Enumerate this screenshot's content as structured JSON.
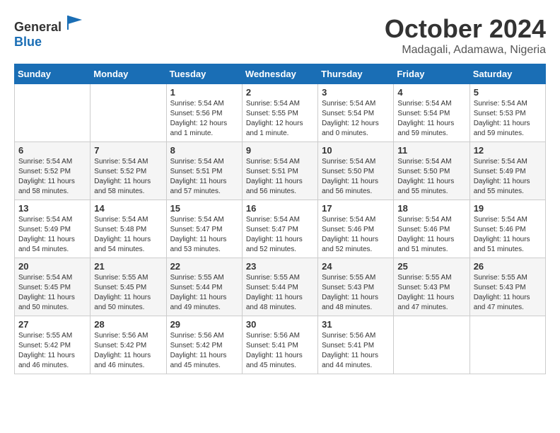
{
  "logo": {
    "general": "General",
    "blue": "Blue"
  },
  "title": "October 2024",
  "location": "Madagali, Adamawa, Nigeria",
  "days_header": [
    "Sunday",
    "Monday",
    "Tuesday",
    "Wednesday",
    "Thursday",
    "Friday",
    "Saturday"
  ],
  "weeks": [
    [
      {
        "day": "",
        "sunrise": "",
        "sunset": "",
        "daylight": ""
      },
      {
        "day": "",
        "sunrise": "",
        "sunset": "",
        "daylight": ""
      },
      {
        "day": "1",
        "sunrise": "Sunrise: 5:54 AM",
        "sunset": "Sunset: 5:56 PM",
        "daylight": "Daylight: 12 hours and 1 minute."
      },
      {
        "day": "2",
        "sunrise": "Sunrise: 5:54 AM",
        "sunset": "Sunset: 5:55 PM",
        "daylight": "Daylight: 12 hours and 1 minute."
      },
      {
        "day": "3",
        "sunrise": "Sunrise: 5:54 AM",
        "sunset": "Sunset: 5:54 PM",
        "daylight": "Daylight: 12 hours and 0 minutes."
      },
      {
        "day": "4",
        "sunrise": "Sunrise: 5:54 AM",
        "sunset": "Sunset: 5:54 PM",
        "daylight": "Daylight: 11 hours and 59 minutes."
      },
      {
        "day": "5",
        "sunrise": "Sunrise: 5:54 AM",
        "sunset": "Sunset: 5:53 PM",
        "daylight": "Daylight: 11 hours and 59 minutes."
      }
    ],
    [
      {
        "day": "6",
        "sunrise": "Sunrise: 5:54 AM",
        "sunset": "Sunset: 5:52 PM",
        "daylight": "Daylight: 11 hours and 58 minutes."
      },
      {
        "day": "7",
        "sunrise": "Sunrise: 5:54 AM",
        "sunset": "Sunset: 5:52 PM",
        "daylight": "Daylight: 11 hours and 58 minutes."
      },
      {
        "day": "8",
        "sunrise": "Sunrise: 5:54 AM",
        "sunset": "Sunset: 5:51 PM",
        "daylight": "Daylight: 11 hours and 57 minutes."
      },
      {
        "day": "9",
        "sunrise": "Sunrise: 5:54 AM",
        "sunset": "Sunset: 5:51 PM",
        "daylight": "Daylight: 11 hours and 56 minutes."
      },
      {
        "day": "10",
        "sunrise": "Sunrise: 5:54 AM",
        "sunset": "Sunset: 5:50 PM",
        "daylight": "Daylight: 11 hours and 56 minutes."
      },
      {
        "day": "11",
        "sunrise": "Sunrise: 5:54 AM",
        "sunset": "Sunset: 5:50 PM",
        "daylight": "Daylight: 11 hours and 55 minutes."
      },
      {
        "day": "12",
        "sunrise": "Sunrise: 5:54 AM",
        "sunset": "Sunset: 5:49 PM",
        "daylight": "Daylight: 11 hours and 55 minutes."
      }
    ],
    [
      {
        "day": "13",
        "sunrise": "Sunrise: 5:54 AM",
        "sunset": "Sunset: 5:49 PM",
        "daylight": "Daylight: 11 hours and 54 minutes."
      },
      {
        "day": "14",
        "sunrise": "Sunrise: 5:54 AM",
        "sunset": "Sunset: 5:48 PM",
        "daylight": "Daylight: 11 hours and 54 minutes."
      },
      {
        "day": "15",
        "sunrise": "Sunrise: 5:54 AM",
        "sunset": "Sunset: 5:47 PM",
        "daylight": "Daylight: 11 hours and 53 minutes."
      },
      {
        "day": "16",
        "sunrise": "Sunrise: 5:54 AM",
        "sunset": "Sunset: 5:47 PM",
        "daylight": "Daylight: 11 hours and 52 minutes."
      },
      {
        "day": "17",
        "sunrise": "Sunrise: 5:54 AM",
        "sunset": "Sunset: 5:46 PM",
        "daylight": "Daylight: 11 hours and 52 minutes."
      },
      {
        "day": "18",
        "sunrise": "Sunrise: 5:54 AM",
        "sunset": "Sunset: 5:46 PM",
        "daylight": "Daylight: 11 hours and 51 minutes."
      },
      {
        "day": "19",
        "sunrise": "Sunrise: 5:54 AM",
        "sunset": "Sunset: 5:46 PM",
        "daylight": "Daylight: 11 hours and 51 minutes."
      }
    ],
    [
      {
        "day": "20",
        "sunrise": "Sunrise: 5:54 AM",
        "sunset": "Sunset: 5:45 PM",
        "daylight": "Daylight: 11 hours and 50 minutes."
      },
      {
        "day": "21",
        "sunrise": "Sunrise: 5:55 AM",
        "sunset": "Sunset: 5:45 PM",
        "daylight": "Daylight: 11 hours and 50 minutes."
      },
      {
        "day": "22",
        "sunrise": "Sunrise: 5:55 AM",
        "sunset": "Sunset: 5:44 PM",
        "daylight": "Daylight: 11 hours and 49 minutes."
      },
      {
        "day": "23",
        "sunrise": "Sunrise: 5:55 AM",
        "sunset": "Sunset: 5:44 PM",
        "daylight": "Daylight: 11 hours and 48 minutes."
      },
      {
        "day": "24",
        "sunrise": "Sunrise: 5:55 AM",
        "sunset": "Sunset: 5:43 PM",
        "daylight": "Daylight: 11 hours and 48 minutes."
      },
      {
        "day": "25",
        "sunrise": "Sunrise: 5:55 AM",
        "sunset": "Sunset: 5:43 PM",
        "daylight": "Daylight: 11 hours and 47 minutes."
      },
      {
        "day": "26",
        "sunrise": "Sunrise: 5:55 AM",
        "sunset": "Sunset: 5:43 PM",
        "daylight": "Daylight: 11 hours and 47 minutes."
      }
    ],
    [
      {
        "day": "27",
        "sunrise": "Sunrise: 5:55 AM",
        "sunset": "Sunset: 5:42 PM",
        "daylight": "Daylight: 11 hours and 46 minutes."
      },
      {
        "day": "28",
        "sunrise": "Sunrise: 5:56 AM",
        "sunset": "Sunset: 5:42 PM",
        "daylight": "Daylight: 11 hours and 46 minutes."
      },
      {
        "day": "29",
        "sunrise": "Sunrise: 5:56 AM",
        "sunset": "Sunset: 5:42 PM",
        "daylight": "Daylight: 11 hours and 45 minutes."
      },
      {
        "day": "30",
        "sunrise": "Sunrise: 5:56 AM",
        "sunset": "Sunset: 5:41 PM",
        "daylight": "Daylight: 11 hours and 45 minutes."
      },
      {
        "day": "31",
        "sunrise": "Sunrise: 5:56 AM",
        "sunset": "Sunset: 5:41 PM",
        "daylight": "Daylight: 11 hours and 44 minutes."
      },
      {
        "day": "",
        "sunrise": "",
        "sunset": "",
        "daylight": ""
      },
      {
        "day": "",
        "sunrise": "",
        "sunset": "",
        "daylight": ""
      }
    ]
  ]
}
